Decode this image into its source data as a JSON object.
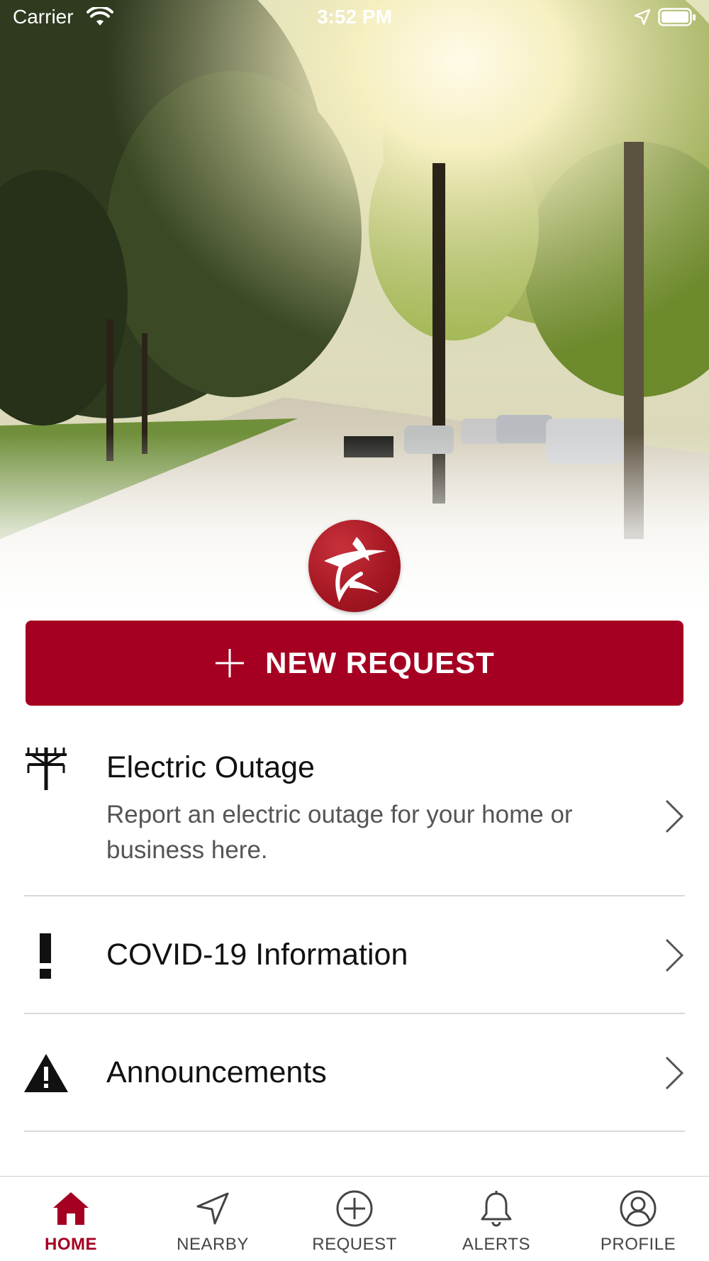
{
  "status_bar": {
    "carrier": "Carrier",
    "time": "3:52 PM"
  },
  "new_request": {
    "label": "NEW REQUEST",
    "icon": "plus-icon"
  },
  "list": [
    {
      "icon": "power-line-icon",
      "title": "Electric Outage",
      "description": "Report an electric outage for your home or business here."
    },
    {
      "icon": "exclamation-icon",
      "title": "COVID-19 Information",
      "description": ""
    },
    {
      "icon": "warning-triangle-icon",
      "title": "Announcements",
      "description": ""
    }
  ],
  "tab_bar": {
    "tabs": [
      {
        "label": "HOME",
        "icon": "home-icon",
        "active": true
      },
      {
        "label": "NEARBY",
        "icon": "location-arrow-icon",
        "active": false
      },
      {
        "label": "REQUEST",
        "icon": "plus-circle-icon",
        "active": false
      },
      {
        "label": "ALERTS",
        "icon": "bell-icon",
        "active": false
      },
      {
        "label": "PROFILE",
        "icon": "user-icon",
        "active": false
      }
    ]
  },
  "colors": {
    "brand_red": "#a50021",
    "active_tab": "#a50021",
    "divider": "#d8d8d8"
  }
}
